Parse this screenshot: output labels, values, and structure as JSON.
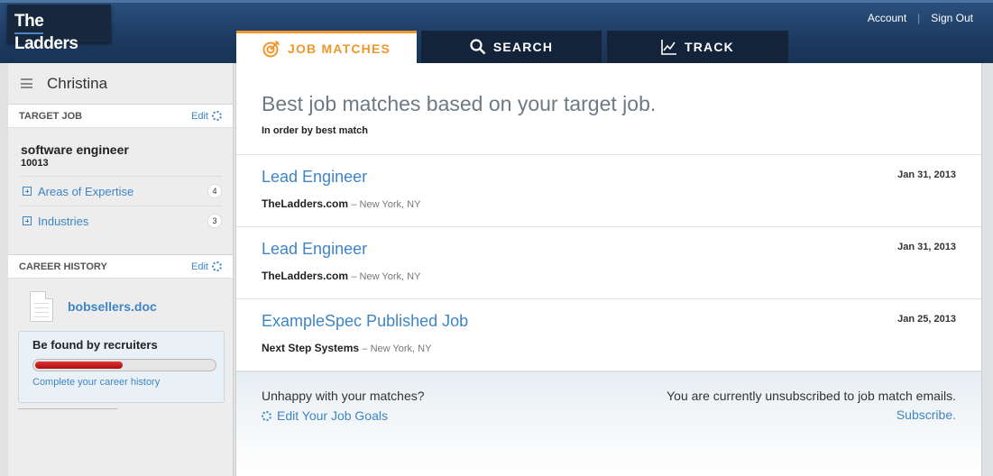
{
  "brand": {
    "logo_text_1": "The",
    "logo_text_2": "Ladders"
  },
  "header": {
    "account_label": "Account",
    "separator": "|",
    "signout_label": "Sign Out"
  },
  "tabs": [
    {
      "label": "JOB MATCHES",
      "icon": "target-icon",
      "active": true
    },
    {
      "label": "SEARCH",
      "icon": "search-icon",
      "active": false
    },
    {
      "label": "TRACK",
      "icon": "chart-icon",
      "active": false
    }
  ],
  "sidebar": {
    "user_name": "Christina",
    "target_job": {
      "heading": "TARGET JOB",
      "edit_label": "Edit",
      "title": "software engineer",
      "zip": "10013",
      "rows": [
        {
          "label": "Areas of Expertise",
          "count": "4"
        },
        {
          "label": "Industries",
          "count": "3"
        }
      ]
    },
    "career_history": {
      "heading": "CAREER HISTORY",
      "edit_label": "Edit",
      "resume_file": "bobsellers.doc",
      "found_title": "Be found by recruiters",
      "progress": 0.5,
      "progress_color": "#c41e1e",
      "complete_link": "Complete your career history"
    }
  },
  "main": {
    "heading": "Best job matches based on your target job.",
    "subheading": "In order by best match",
    "jobs": [
      {
        "title": "Lead Engineer",
        "company": "TheLadders.com",
        "location": "– New York, NY",
        "date": "Jan 31, 2013"
      },
      {
        "title": "Lead Engineer",
        "company": "TheLadders.com",
        "location": "– New York, NY",
        "date": "Jan 31, 2013"
      },
      {
        "title": "ExampleSpec Published Job",
        "company": "Next Step Systems",
        "location": "– New York, NY",
        "date": "Jan 25, 2013"
      }
    ],
    "footer": {
      "unhappy_text": "Unhappy with your matches?",
      "edit_goals_label": "Edit Your Job Goals",
      "unsubscribed_text": "You are currently unsubscribed to job match emails.",
      "subscribe_label": "Subscribe."
    }
  },
  "colors": {
    "accent_orange": "#f0962a",
    "link_blue": "#3e85c5",
    "nav_dark": "#13233a",
    "header_blue": "#1d3b62"
  }
}
